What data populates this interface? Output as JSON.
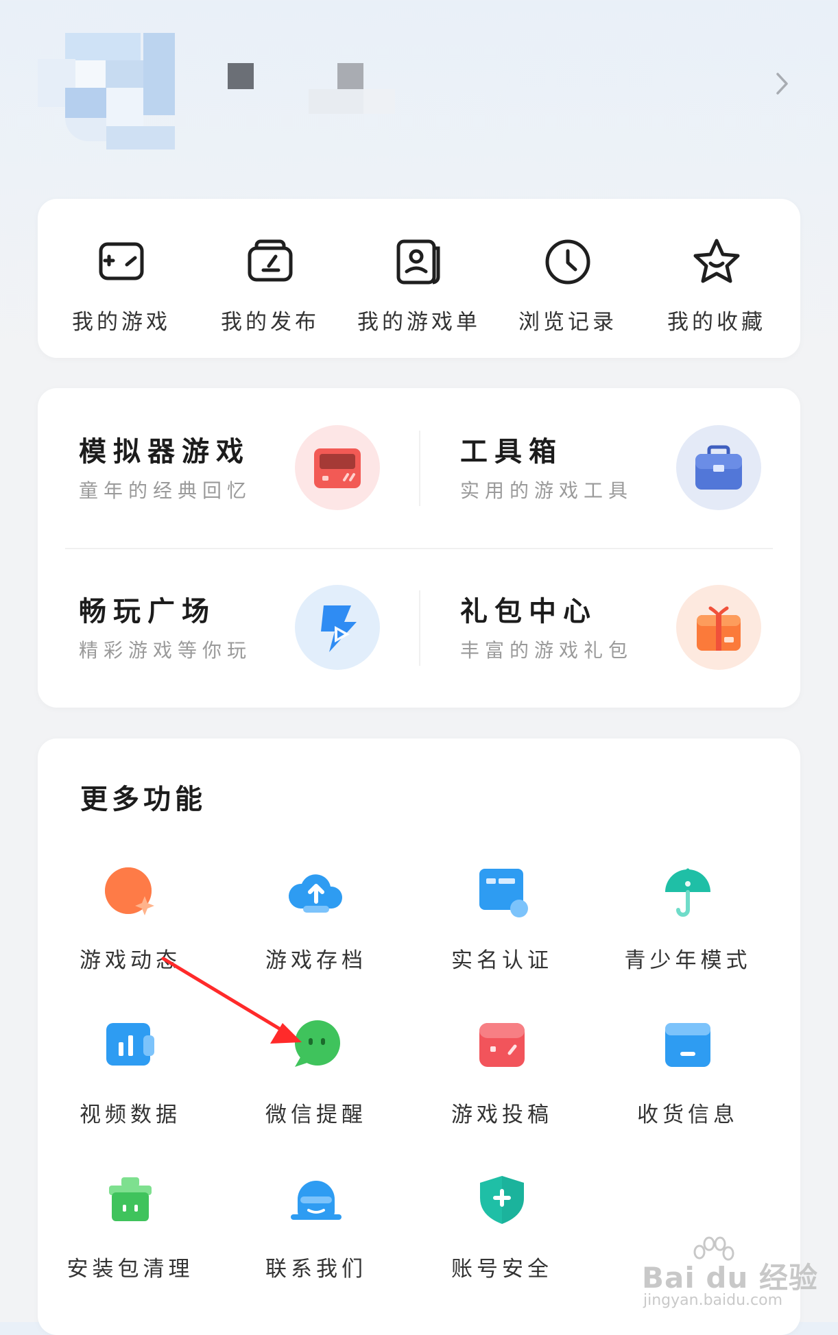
{
  "header": {
    "profile_icon": "chevron-right-icon"
  },
  "quick_actions": [
    {
      "label": "我的游戏",
      "icon": "gamepad-icon"
    },
    {
      "label": "我的发布",
      "icon": "edit-publish-icon"
    },
    {
      "label": "我的游戏单",
      "icon": "game-list-icon"
    },
    {
      "label": "浏览记录",
      "icon": "clock-icon"
    },
    {
      "label": "我的收藏",
      "icon": "star-icon"
    }
  ],
  "services": [
    {
      "title": "模拟器游戏",
      "subtitle": "童年的经典回忆",
      "icon": "emulator-console-icon",
      "color": "#f0564f"
    },
    {
      "title": "工具箱",
      "subtitle": "实用的游戏工具",
      "icon": "toolbox-icon",
      "color": "#4f73d9"
    },
    {
      "title": "畅玩广场",
      "subtitle": "精彩游戏等你玩",
      "icon": "play-square-icon",
      "color": "#2f8cf3"
    },
    {
      "title": "礼包中心",
      "subtitle": "丰富的游戏礼包",
      "icon": "gift-icon",
      "color": "#fb7a3a"
    }
  ],
  "more": {
    "title": "更多功能",
    "items": [
      {
        "label": "游戏动态",
        "icon": "game-news-icon",
        "color": "#fd6c3c"
      },
      {
        "label": "游戏存档",
        "icon": "cloud-upload-icon",
        "color": "#2e9cf2"
      },
      {
        "label": "实名认证",
        "icon": "id-card-icon",
        "color": "#2e9cf2"
      },
      {
        "label": "青少年模式",
        "icon": "umbrella-icon",
        "color": "#1fbfa6"
      },
      {
        "label": "视频数据",
        "icon": "video-stats-icon",
        "color": "#2e9cf2"
      },
      {
        "label": "微信提醒",
        "icon": "wechat-icon",
        "color": "#3fc35c"
      },
      {
        "label": "游戏投稿",
        "icon": "game-submit-icon",
        "color": "#f2545b"
      },
      {
        "label": "收货信息",
        "icon": "address-icon",
        "color": "#2e9cf2"
      },
      {
        "label": "安装包清理",
        "icon": "cleanup-icon",
        "color": "#3fc35c"
      },
      {
        "label": "联系我们",
        "icon": "customer-service-icon",
        "color": "#2e9cf2"
      },
      {
        "label": "账号安全",
        "icon": "shield-icon",
        "color": "#1fbfa6"
      }
    ]
  },
  "watermark": {
    "main": "Bai du 经验",
    "url": "jingyan.baidu.com"
  },
  "colors": {
    "annotation_arrow": "#ff2a2a"
  }
}
